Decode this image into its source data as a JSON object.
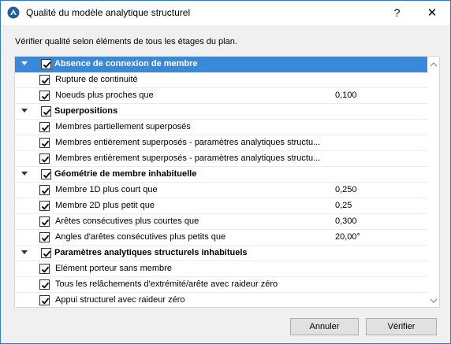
{
  "window": {
    "title": "Qualité du modèle analytique structurel",
    "help": "?",
    "close": "✕"
  },
  "instruction": "Vérifier qualité selon éléments de tous les étages du plan.",
  "groups": [
    {
      "label": "Absence de connexion de membre",
      "checked": true,
      "selected": true,
      "items": [
        {
          "label": "Rupture de continuité",
          "value": "",
          "checked": true
        },
        {
          "label": "Noeuds plus proches que",
          "value": "0,100",
          "checked": true
        }
      ]
    },
    {
      "label": "Superpositions",
      "checked": true,
      "items": [
        {
          "label": "Membres partiellement superposés",
          "value": "",
          "checked": true
        },
        {
          "label": "Membres entièrement superposés - paramètres analytiques structu...",
          "value": "",
          "checked": true
        },
        {
          "label": "Membres entièrement superposés - paramètres analytiques structu...",
          "value": "",
          "checked": true
        }
      ]
    },
    {
      "label": "Géométrie de membre inhabituelle",
      "checked": true,
      "items": [
        {
          "label": "Membre 1D plus court que",
          "value": "0,250",
          "checked": true
        },
        {
          "label": "Membre 2D plus petit que",
          "value": "0,25",
          "checked": true
        },
        {
          "label": "Arêtes consécutives plus courtes que",
          "value": "0,300",
          "checked": true
        },
        {
          "label": "Angles d'arêtes consécutives plus petits que",
          "value": "20,00°",
          "checked": true
        }
      ]
    },
    {
      "label": "Paramètres analytiques structurels inhabituels",
      "checked": true,
      "items": [
        {
          "label": "Elément porteur sans membre",
          "value": "",
          "checked": true
        },
        {
          "label": "Tous les relâchements d'extrémité/arête avec raideur zéro",
          "value": "",
          "checked": true
        },
        {
          "label": "Appui structurel avec raideur zéro",
          "value": "",
          "checked": true
        }
      ]
    }
  ],
  "buttons": {
    "cancel": "Annuler",
    "verify": "Vérifier"
  },
  "colors": {
    "selection": "#3a88d8",
    "window_border": "#2b79d0"
  }
}
